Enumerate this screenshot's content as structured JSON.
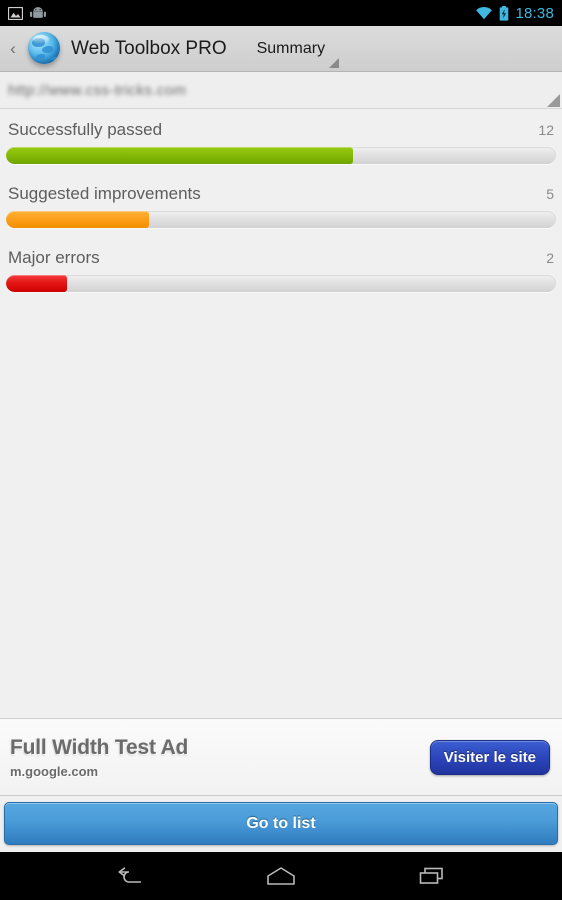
{
  "statusbar": {
    "time": "18:38",
    "icons": [
      "screenshot-icon",
      "android-icon",
      "wifi-icon",
      "battery-charging-icon"
    ]
  },
  "actionbar": {
    "up_caret": "‹",
    "app_icon": "globe-icon",
    "title": "Web Toolbox PRO",
    "spinner_label": "Summary"
  },
  "urlbar": {
    "url": "http://www.css-tricks.com"
  },
  "stats": [
    {
      "label": "Successfully passed",
      "count": "12",
      "percent": 63,
      "color": "#86bb06",
      "tone": "green"
    },
    {
      "label": "Suggested improvements",
      "count": "5",
      "percent": 26,
      "color": "#fda01b",
      "tone": "orange"
    },
    {
      "label": "Major errors",
      "count": "2",
      "percent": 11,
      "color": "#e51616",
      "tone": "red"
    }
  ],
  "ad": {
    "title": "Full Width Test Ad",
    "url": "m.google.com",
    "button_label": "Visiter le site"
  },
  "cta": {
    "label": "Go to list"
  },
  "navbar": {
    "back": "back-icon",
    "home": "home-icon",
    "recents": "recents-icon"
  }
}
